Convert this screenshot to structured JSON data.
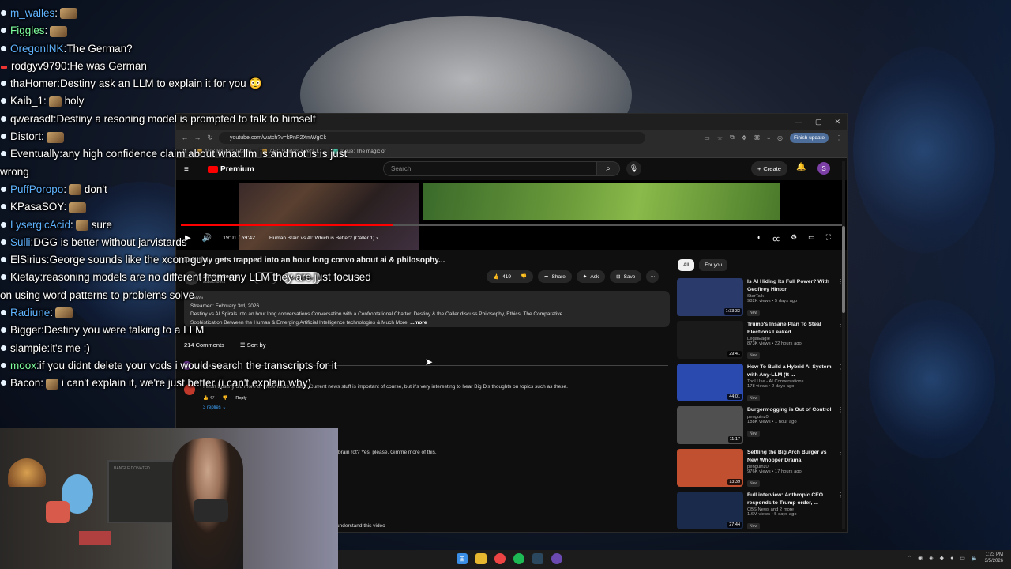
{
  "chat": [
    {
      "user": "m_walles",
      "color": "#5fb3ff",
      "msg": "",
      "emote": true
    },
    {
      "user": "Figgles",
      "color": "#7fff9f",
      "msg": "",
      "emote": true
    },
    {
      "user": "OregonINK",
      "color": "#5fb3ff",
      "msg": "The German?"
    },
    {
      "user": "rodgyv9790",
      "color": "#ffffff",
      "msg": "He was German",
      "red": true
    },
    {
      "user": "thaHomer",
      "color": "#ffffff",
      "msg": "Destiny ask an LLM to explain it for you 😳"
    },
    {
      "user": "Kaib_1",
      "color": "#ffffff",
      "msg": "holy",
      "emote": true
    },
    {
      "user": "qwerasdf",
      "color": "#ffffff",
      "msg": "Destiny a resoning model is prompted to talk to himself"
    },
    {
      "user": "Distort",
      "color": "#ffffff",
      "msg": "",
      "emote": true
    },
    {
      "user": "Eventually",
      "color": "#ffffff",
      "msg": "any high confidence claim about what llm is and not is is just wrong",
      "emote": true
    },
    {
      "user": "PuffPoropo",
      "color": "#5fb3ff",
      "msg": "don't",
      "emote": true
    },
    {
      "user": "KPasaSOY",
      "color": "#ffffff",
      "msg": "",
      "emote": true
    },
    {
      "user": "LysergicAcid",
      "color": "#5fb3ff",
      "msg": "sure",
      "emote": true
    },
    {
      "user": "Sulli",
      "color": "#5fb3ff",
      "msg": "DGG is better without jarvistards"
    },
    {
      "user": "ElSirius",
      "color": "#ffffff",
      "msg": "George sounds like the xcom guy"
    },
    {
      "user": "Kietay",
      "color": "#ffffff",
      "msg": "reasoning models are no different from any LLM they are just focused on using word patterns to problems solve"
    },
    {
      "user": "Radiune",
      "color": "#5fb3ff",
      "msg": "",
      "emote": true
    },
    {
      "user": "Bigger",
      "color": "#ffffff",
      "msg": "Destiny you were talking to a LLM"
    },
    {
      "user": "slampie",
      "color": "#ffffff",
      "msg": "it's me :)"
    },
    {
      "user": "moox",
      "color": "#7fff9f",
      "msg": "if you didnt delete your vods i would search the transcripts for it",
      "emote": true
    },
    {
      "user": "Bacon",
      "color": "#ffffff",
      "msg": "i can't explain it, we're just better (i can't explain why)",
      "emote": true
    }
  ],
  "browser": {
    "url": "youtube.com/watch?v=kPnP2XmWgCk",
    "finish_update": "Finish update",
    "bookmarks": [
      "ARC Raiders Interac",
      "ARC Raiders Event T...",
      "Ingue: The magic of"
    ],
    "window_controls": [
      "—",
      "▢",
      "✕"
    ]
  },
  "youtube": {
    "logo": "Premium",
    "search_placeholder": "Search",
    "create_label": "Create",
    "avatar_letter": "S",
    "player": {
      "time": "19:01 / 59:42",
      "chapter": "Human Brain vs AI: Which is Better? (Caller 1) ›",
      "progress": 0.32
    },
    "video_title": "Destiny gets trapped into an hour long convo about ai & philosophy...",
    "channel": {
      "name": "10minuteads",
      "subs": "subscribers"
    },
    "join": "Join",
    "subscribe": "Subscribe",
    "likes": "419",
    "share": "Share",
    "ask": "Ask",
    "save": "Save",
    "description": {
      "views": "views",
      "streamed": "Streamed: February 3rd, 2026",
      "line1": "Destiny vs AI Spirals into an hour long conversations Conversation with a Confrontational Chatter. Destiny & the Caller discuss Philosophy, Ethics, The Comparative",
      "line2": "Sophistication Between the Human & Emerging Artificial Intelligence technologies & Much More!",
      "more": "...more"
    },
    "comments_count": "214 Comments",
    "sort_by": "Sort by",
    "add_comment": "Add a comment...",
    "comments": [
      {
        "text": "I wish Epstiny did more of these kinds of talks. Current news stuff is important of course, but it's very interesting to hear Big D's thoughts on topics such as these.",
        "likes": "47",
        "reply": "Reply",
        "replies": "3 replies"
      },
      {
        "text": "brain rot? Yes, please. Gimme more of this."
      },
      {
        "text": "understand this video"
      }
    ],
    "chips": [
      "All",
      "For you"
    ],
    "recommendations": [
      {
        "title": "Is AI Hiding Its Full Power? With Geoffrey Hinton",
        "channel": "StarTalk",
        "meta": "982K views • 5 days ago",
        "badge": "New",
        "duration": "1:33:33",
        "thumb": "#2a3a6a"
      },
      {
        "title": "Trump's Insane Plan To Steal Elections Leaked",
        "channel": "LegalEagle",
        "meta": "873K views • 22 hours ago",
        "badge": "New",
        "duration": "29:41",
        "thumb": "#1a1a1a"
      },
      {
        "title": "How To Build a Hybrid AI System with Any-LLM (ft ...",
        "channel": "Tool Use - AI Conversations",
        "meta": "178 views • 2 days ago",
        "badge": "New",
        "duration": "44:01",
        "thumb": "#2a4ab0"
      },
      {
        "title": "Burgermogging is Out of Control",
        "channel": "penguinz0",
        "meta": "188K views • 1 hour ago",
        "badge": "New",
        "duration": "11:17",
        "thumb": "#505050"
      },
      {
        "title": "Settling the Big Arch Burger vs New Whopper Drama",
        "channel": "penguinz0",
        "meta": "976K views • 17 hours ago",
        "badge": "New",
        "duration": "13:39",
        "thumb": "#c05030"
      },
      {
        "title": "Full interview: Anthropic CEO responds to Trump order, ...",
        "channel": "CBS News and 2 more",
        "meta": "1.6M views • 5 days ago",
        "badge": "New",
        "duration": "27:44",
        "thumb": "#1a2a4a"
      }
    ]
  },
  "webcam": {
    "sign": "BANGLE DONATED"
  },
  "taskbar": {
    "time": "1:23 PM",
    "date": "3/5/2026"
  }
}
